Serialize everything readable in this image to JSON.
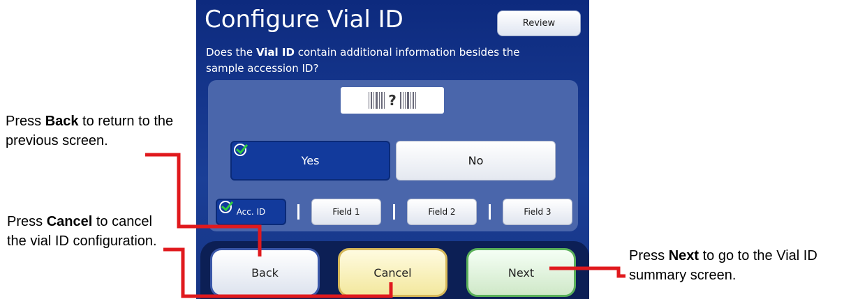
{
  "screen": {
    "title": "Configure Vial ID",
    "review_label": "Review",
    "question": {
      "prefix": "Does the ",
      "emphasis": "Vial ID",
      "suffix": " contain additional information besides the sample accession ID?"
    },
    "barcode_symbol": "?",
    "choices": [
      {
        "label": "Yes",
        "selected": true
      },
      {
        "label": "No",
        "selected": false
      }
    ],
    "fields": [
      {
        "label": "Acc. ID",
        "selected": true
      },
      {
        "label": "Field 1",
        "selected": false
      },
      {
        "label": "Field 2",
        "selected": false
      },
      {
        "label": "Field 3",
        "selected": false
      }
    ],
    "nav": {
      "back": "Back",
      "cancel": "Cancel",
      "next": "Next"
    }
  },
  "callouts": {
    "back": {
      "pre": "Press ",
      "bold": "Back",
      "post": " to return to the previous screen."
    },
    "cancel": {
      "pre": "Press ",
      "bold": "Cancel",
      "post": " to cancel the vial ID configuration."
    },
    "next": {
      "pre": "Press ",
      "bold": "Next",
      "post": " to go to the Vial ID summary screen."
    }
  },
  "colors": {
    "screen_bg": "#1b3f97",
    "selected": "#123a9c",
    "leader_line": "#e0191d",
    "check": "#2ecc40"
  }
}
